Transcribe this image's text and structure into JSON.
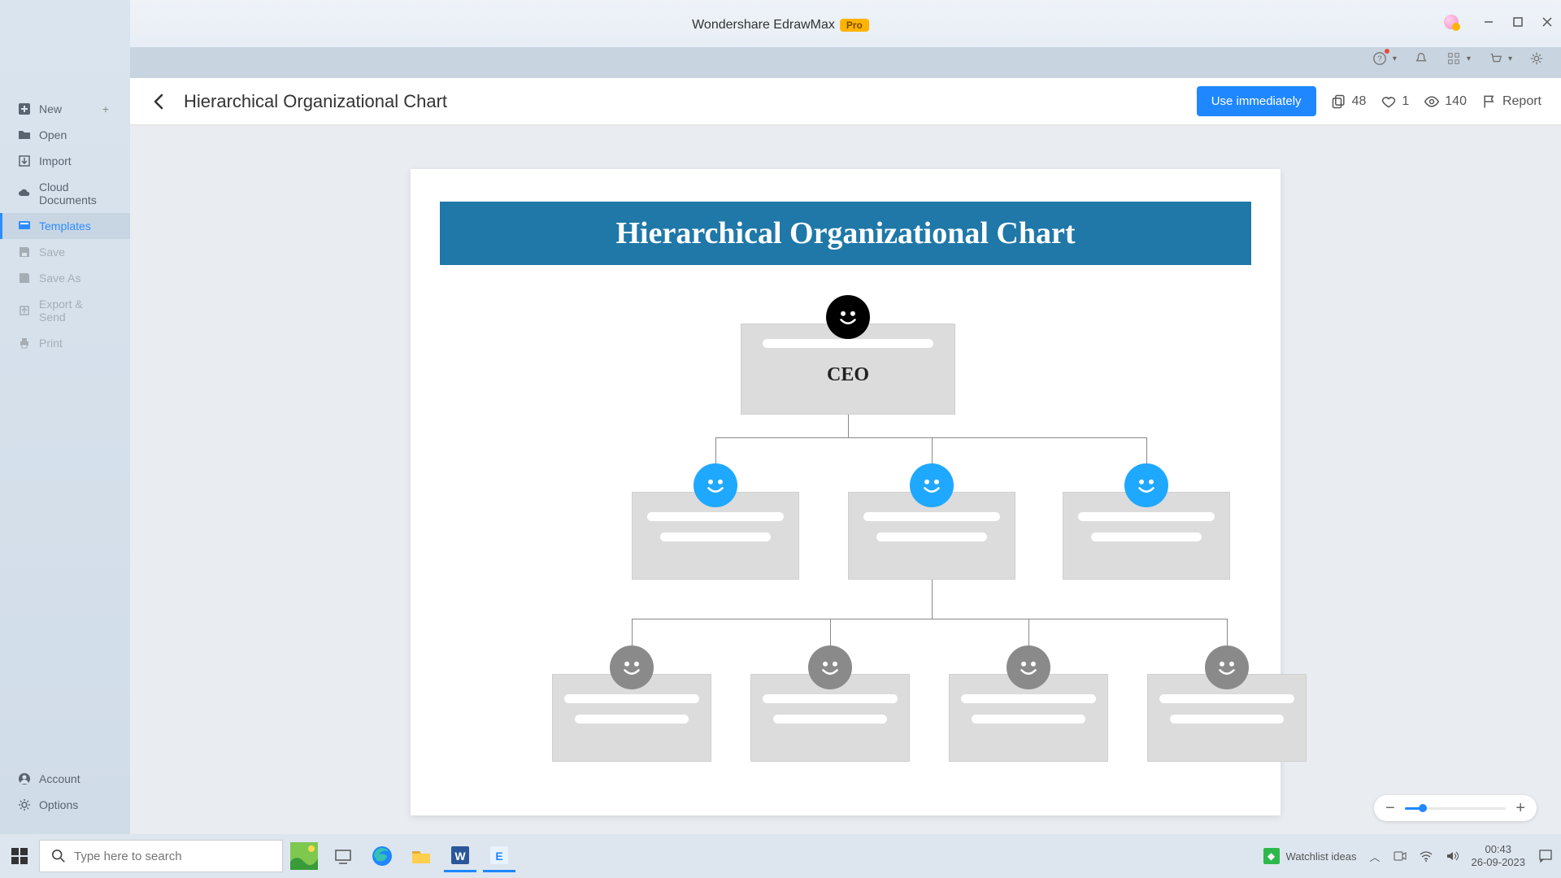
{
  "app": {
    "title": "Wondershare EdrawMax",
    "badge": "Pro"
  },
  "win": {
    "min": "–",
    "max": "❐",
    "close": "✕"
  },
  "sidebar": {
    "items": [
      {
        "label": "New",
        "icon": "plus-square"
      },
      {
        "label": "Open",
        "icon": "folder"
      },
      {
        "label": "Import",
        "icon": "import"
      },
      {
        "label": "Cloud Documents",
        "icon": "cloud"
      },
      {
        "label": "Templates",
        "icon": "template"
      },
      {
        "label": "Save",
        "icon": "save"
      },
      {
        "label": "Save As",
        "icon": "save-as"
      },
      {
        "label": "Export & Send",
        "icon": "export"
      },
      {
        "label": "Print",
        "icon": "print"
      }
    ],
    "bottom": [
      {
        "label": "Account",
        "icon": "account"
      },
      {
        "label": "Options",
        "icon": "gear"
      }
    ]
  },
  "header": {
    "title": "Hierarchical Organizational Chart",
    "use_btn": "Use immediately",
    "copies": "48",
    "likes": "1",
    "views": "140",
    "report": "Report"
  },
  "chart": {
    "title": "Hierarchical Organizational Chart",
    "ceo_label": "CEO"
  },
  "chart_data": {
    "type": "table",
    "title": "Hierarchical Organizational Chart",
    "levels": [
      {
        "level": 1,
        "count": 1,
        "nodes": [
          {
            "label": "CEO",
            "face": "black"
          }
        ]
      },
      {
        "level": 2,
        "count": 3,
        "nodes": [
          {
            "label": "",
            "face": "blue"
          },
          {
            "label": "",
            "face": "blue"
          },
          {
            "label": "",
            "face": "blue"
          }
        ]
      },
      {
        "level": 3,
        "count": 4,
        "nodes": [
          {
            "label": "",
            "face": "gray"
          },
          {
            "label": "",
            "face": "gray"
          },
          {
            "label": "",
            "face": "gray"
          },
          {
            "label": "",
            "face": "gray"
          }
        ]
      }
    ]
  },
  "taskbar": {
    "search_placeholder": "Type here to search",
    "watchlist": "Watchlist ideas",
    "time": "00:43",
    "date": "26-09-2023"
  }
}
